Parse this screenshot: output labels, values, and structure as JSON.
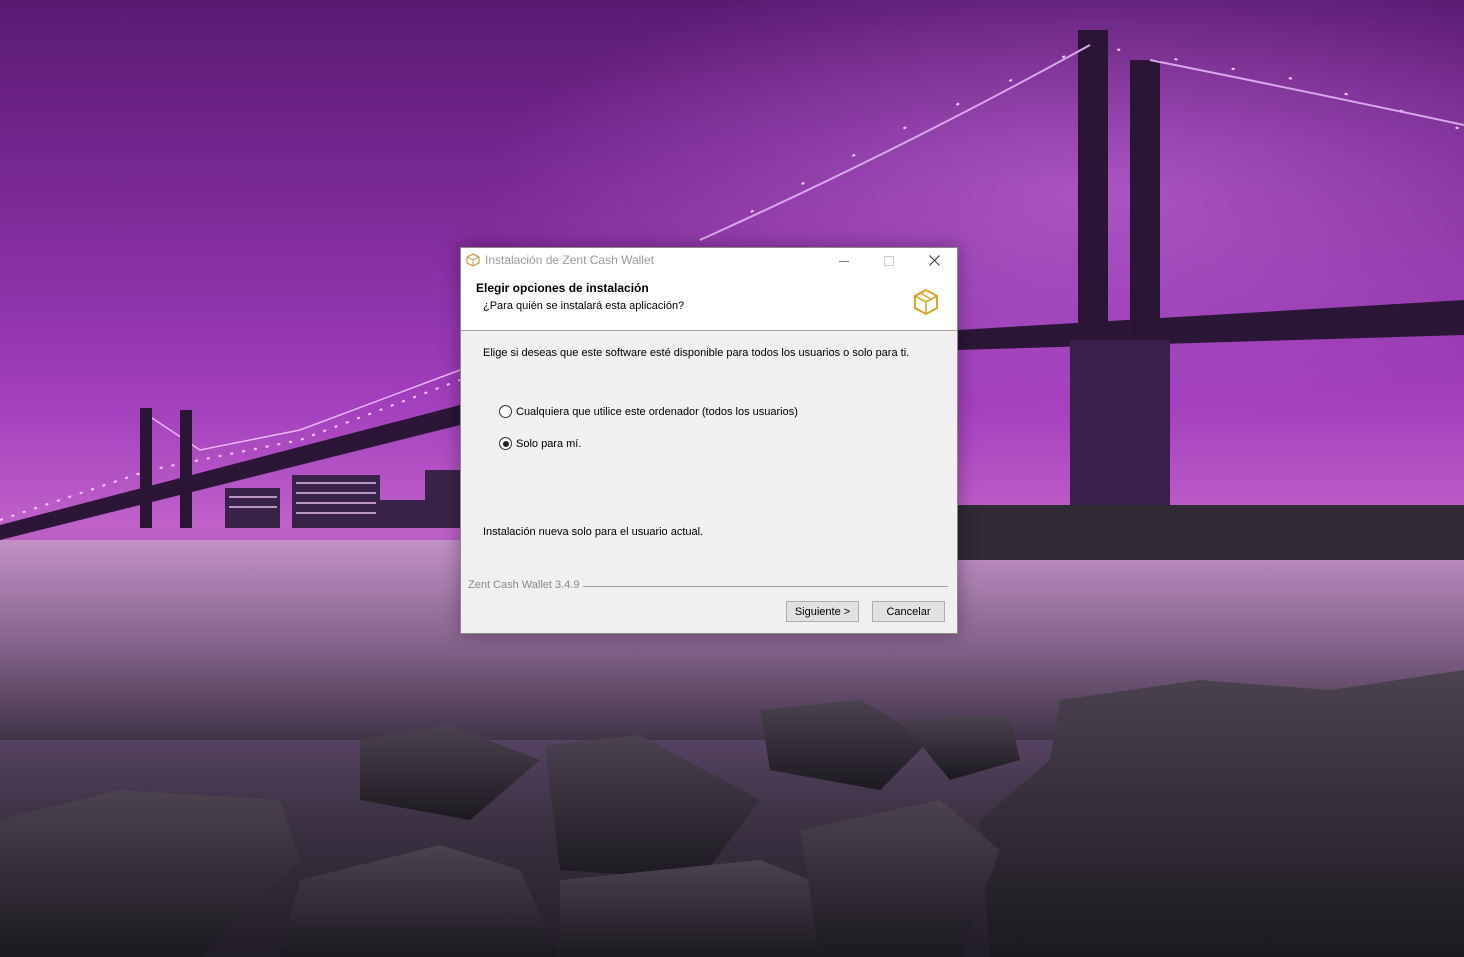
{
  "window": {
    "title": "Instalación de Zent Cash Wallet",
    "app_icon": "zent-cube-icon",
    "controls": [
      "minimize-icon",
      "maximize-icon",
      "close-icon"
    ]
  },
  "header": {
    "title": "Elegir opciones de instalación",
    "subtitle": "¿Para quién se instalará esta aplicación?",
    "icon": "zent-cube-icon"
  },
  "body": {
    "description": "Elige si deseas que este software esté disponible para todos los usuarios o solo para ti.",
    "options": [
      {
        "label": "Cualquiera que utilice este ordenador (todos los usuarios)",
        "selected": false
      },
      {
        "label": "Solo para mí.",
        "selected": true
      }
    ],
    "status": "Instalación nueva solo para el usuario actual."
  },
  "footer": {
    "version": "Zent Cash Wallet 3.4.9",
    "next_label": "Siguiente >",
    "cancel_label": "Cancelar"
  },
  "colors": {
    "accent": "#d9a628",
    "wallpaper_purple": "#a23fbd"
  }
}
